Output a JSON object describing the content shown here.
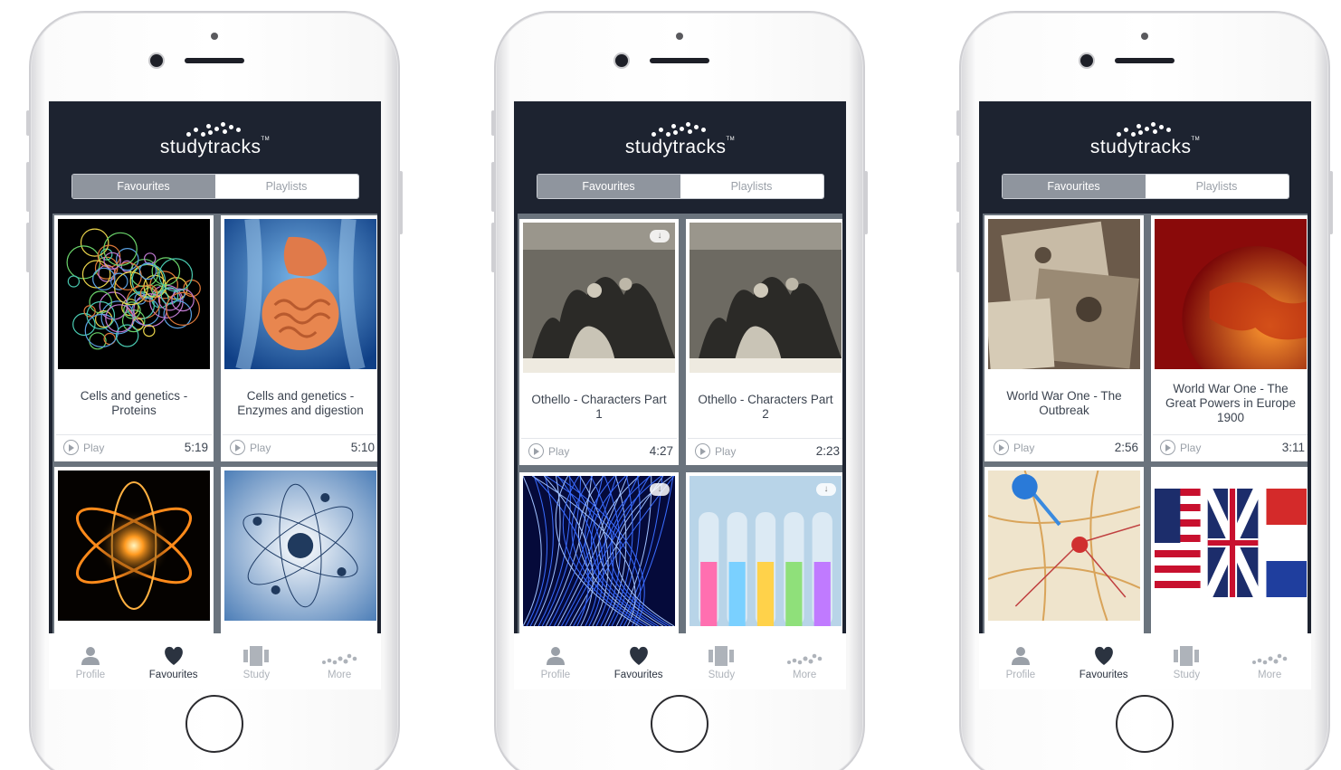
{
  "app": {
    "brand": "studytracks",
    "trademark": "TM"
  },
  "colors": {
    "header_bg": "#1d2330",
    "segment_active": "#8f959e",
    "tab_active": "#2b3340",
    "tab_inactive": "#aeb3ba"
  },
  "segmented": {
    "favourites": "Favourites",
    "playlists": "Playlists"
  },
  "tabs": [
    {
      "label": "Profile",
      "icon": "profile-icon"
    },
    {
      "label": "Favourites",
      "icon": "heart-icon"
    },
    {
      "label": "Study",
      "icon": "study-icon"
    },
    {
      "label": "More",
      "icon": "more-dots-icon"
    }
  ],
  "play_label": "Play",
  "phones": [
    {
      "active_segment": "Favourites",
      "active_tab": "Favourites",
      "cards": [
        {
          "title": "Cells and genetics - Proteins",
          "duration": "5:19",
          "image": "protein-structure"
        },
        {
          "title": "Cells and genetics - Enzymes and digestion",
          "duration": "5:10",
          "image": "digestive-system"
        },
        {
          "title": "",
          "duration": "",
          "image": "glowing-atom"
        },
        {
          "title": "",
          "duration": "",
          "image": "atom-model"
        }
      ]
    },
    {
      "active_segment": "Favourites",
      "active_tab": "Favourites",
      "cards": [
        {
          "title": "Othello - Characters Part 1",
          "duration": "4:27",
          "image": "engraving-scene",
          "download": true
        },
        {
          "title": "Othello - Characters Part 2",
          "duration": "2:23",
          "image": "engraving-scene"
        },
        {
          "title": "",
          "duration": "",
          "image": "blue-fibres",
          "download": true
        },
        {
          "title": "",
          "duration": "",
          "image": "test-tubes",
          "download": true
        }
      ]
    },
    {
      "active_segment": "Favourites",
      "active_tab": "Favourites",
      "cards": [
        {
          "title": "World War One - The Outbreak",
          "duration": "2:56",
          "image": "old-photographs"
        },
        {
          "title": "World War One - The Great Powers in Europe 1900",
          "duration": "3:11",
          "image": "red-globe"
        },
        {
          "title": "",
          "duration": "",
          "image": "map-pin-france"
        },
        {
          "title": "",
          "duration": "",
          "image": "flags"
        }
      ]
    }
  ]
}
